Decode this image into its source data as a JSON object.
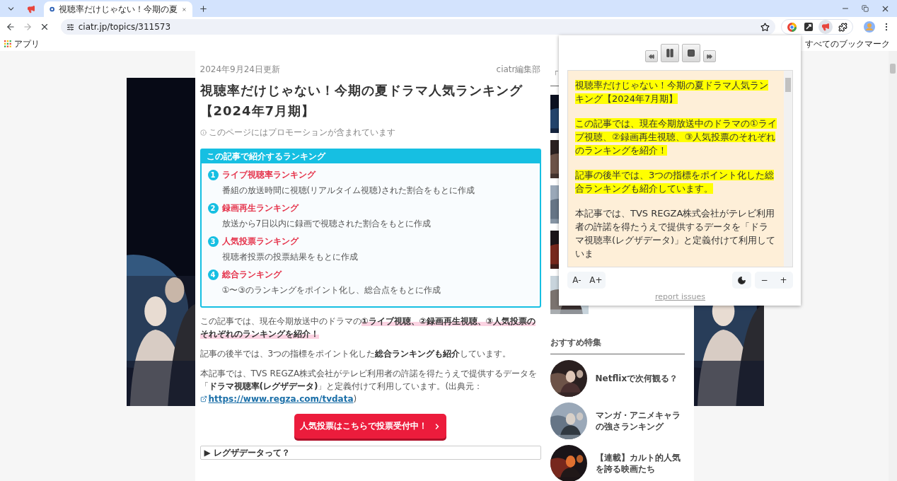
{
  "browser": {
    "tabs": [
      {
        "kind": "pinned",
        "selected": false
      },
      {
        "kind": "page",
        "title": "視聴率だけじゃない！今期の夏",
        "selected": true
      }
    ],
    "url": "ciatr.jp/topics/311573",
    "bookmarks": {
      "apps": "アプリ",
      "all": "すべてのブックマーク"
    }
  },
  "article": {
    "date": "2024年9月24日更新",
    "author": "ciatr編集部",
    "title": "視聴率だけじゃない！今期の夏ドラマ人気ランキング【2024年7月期】",
    "promo_note": "このページにはプロモーションが含まれています",
    "ranking_box": {
      "heading": "この記事で紹介するランキング",
      "items": [
        {
          "number": "1",
          "title": "ライブ視聴率ランキング",
          "description": "番組の放送時間に視聴(リアルタイム視聴)された割合をもとに作成"
        },
        {
          "number": "2",
          "title": "録画再生ランキング",
          "description": "放送から7日以内に録画で視聴された割合をもとに作成"
        },
        {
          "number": "3",
          "title": "人気投票ランキング",
          "description": "視聴者投票の投票結果をもとに作成"
        },
        {
          "number": "4",
          "title": "総合ランキング",
          "description": "①〜③のランキングをポイント化し、総合点をもとに作成"
        }
      ]
    },
    "paragraphs": [
      {
        "highlight": true,
        "text": "この記事では、現在今期放送中のドラマの**①ライブ視聴、②録画再生視聴、③人気投票のそれぞれのランキングを紹介！**"
      },
      {
        "highlight": false,
        "text": "記事の後半では、3つの指標をポイント化した**総合ランキングも紹介**しています。"
      },
      {
        "highlight": false,
        "text": "本記事では、TVS REGZA株式会社がテレビ利用者の許諾を得たうえで提供するデータを「**ドラマ視聴率(レグザデータ)**」と定義付けて利用しています。(出典元：",
        "link": "https://www.regza.com/tvdata",
        "after": ")"
      }
    ],
    "vote_button": "人気投票はこちらで投票受付中！",
    "details": {
      "marker": "▶",
      "label": "レグザデータって？"
    }
  },
  "sidebar": {
    "heading": "「",
    "featured_heading": "おすすめ特集",
    "featured": [
      {
        "title": "Netflixで次何観る？"
      },
      {
        "title": "マンガ・アニメキャラの強さランキング"
      },
      {
        "title": "【連載】カルト的人気を誇る映画たち"
      }
    ]
  },
  "reader_popup": {
    "paragraphs": [
      {
        "highlighted": true,
        "text": "視聴率だけじゃない！今期の夏ドラマ人気ランキング【2024年7月期】"
      },
      {
        "highlighted": true,
        "text": "この記事では、現在今期放送中のドラマの①ライブ視聴、②録画再生視聴、③人気投票のそれぞれのランキングを紹介！"
      },
      {
        "highlighted": true,
        "text": "記事の後半では、3つの指標をポイント化した総合ランキングも紹介しています。"
      },
      {
        "highlighted": false,
        "text": "本記事では、TVS REGZA株式会社がテレビ利用者の許諾を得たうえで提供するデータを「ドラマ視聴率(レグザデータ)」と定義付けて利用していま"
      }
    ],
    "font_buttons": [
      "A-",
      "A+"
    ],
    "speed_buttons": [
      "−",
      "+"
    ],
    "report_link": "report issues"
  }
}
